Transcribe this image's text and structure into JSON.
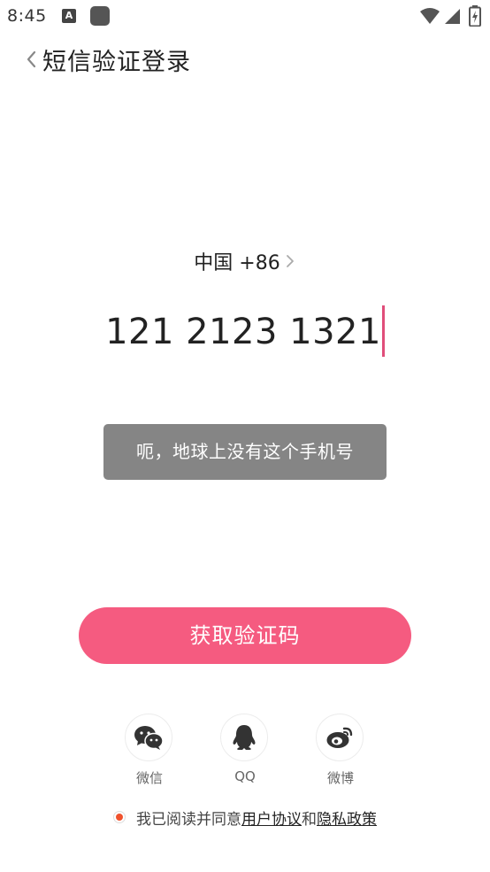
{
  "status_bar": {
    "time": "8:45",
    "notification_letter": "A"
  },
  "header": {
    "back_icon": "chevron-left-icon",
    "title": "短信验证登录"
  },
  "country": {
    "label": "中国 +86",
    "chevron_icon": "chevron-right-icon"
  },
  "phone": {
    "value": "121 2123 1321",
    "caret_color": "#e04e7a"
  },
  "toast": {
    "message": "呃，地球上没有这个手机号"
  },
  "action": {
    "get_code_label": "获取验证码",
    "color": "#f55b80"
  },
  "social": [
    {
      "label": "微信",
      "icon": "wechat-icon"
    },
    {
      "label": "QQ",
      "icon": "qq-icon"
    },
    {
      "label": "微博",
      "icon": "weibo-icon"
    }
  ],
  "agreement": {
    "prefix": "我已阅读并同意",
    "user_agreement": "用户协议",
    "conjunction": "和",
    "privacy_policy": "隐私政策",
    "radio_color": "#f0522d"
  }
}
